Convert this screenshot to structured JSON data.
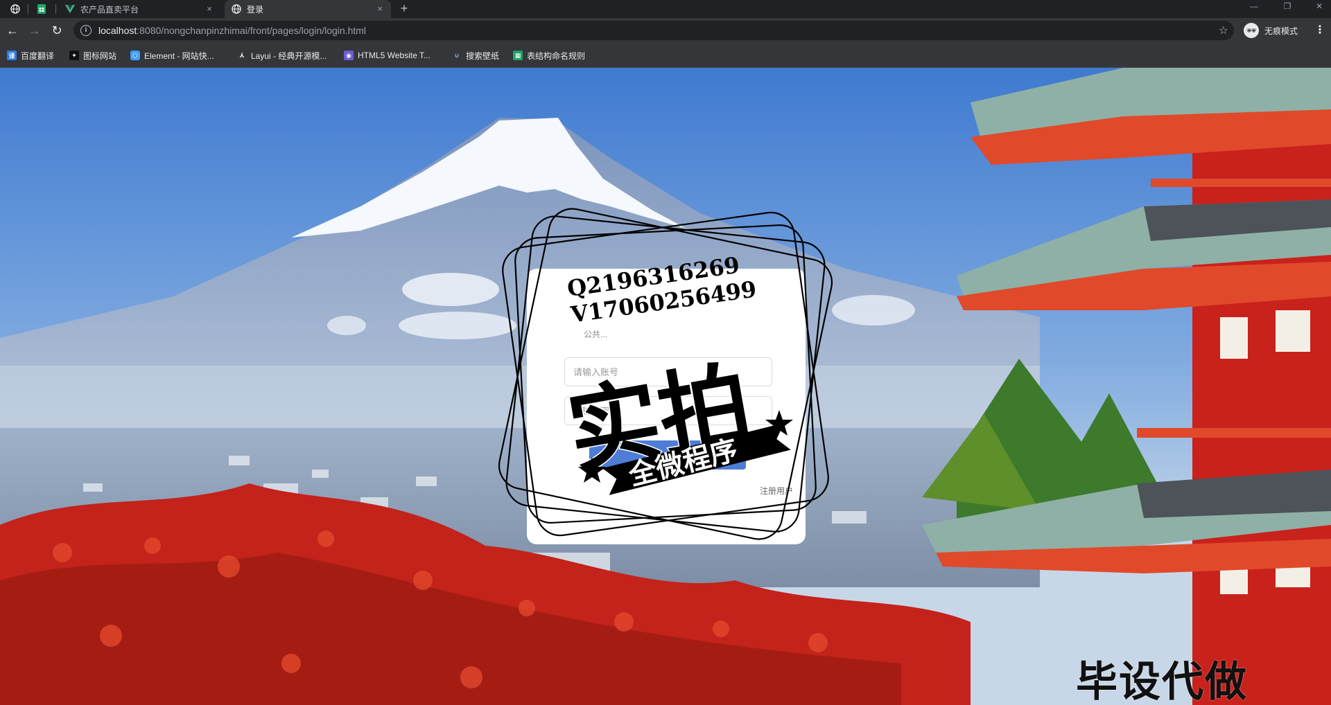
{
  "browser": {
    "tabs": [
      {
        "title": "",
        "icon": "globe-icon",
        "pinned": true
      },
      {
        "title": "",
        "icon": "sheets-icon",
        "pinned": true
      },
      {
        "title": "农产品直卖平台",
        "icon": "vue-icon",
        "active": false,
        "close": "×"
      },
      {
        "title": "登录",
        "icon": "globe-icon",
        "active": true,
        "close": "×"
      }
    ],
    "new_tab": "+",
    "url": {
      "host": "localhost",
      "rest": ":8080/nongchanpinzhimai/front/pages/login/login.html"
    },
    "incognito_label": "无痕模式",
    "bookmarks": [
      {
        "label": "百度翻译",
        "icon": "baidu-translate-icon",
        "color": "#2d7be5"
      },
      {
        "label": "图标网站",
        "icon": "iconfont-icon",
        "color": "#222222"
      },
      {
        "label": "Element - 网站快...",
        "icon": "element-icon",
        "color": "#409eff"
      },
      {
        "label": "Layui - 经典开源模...",
        "icon": "layui-icon",
        "color": "#555555"
      },
      {
        "label": "HTML5 Website T...",
        "icon": "html5-template-icon",
        "color": "#6b5bd6"
      },
      {
        "label": "搜索壁纸",
        "icon": "wallpaper-icon",
        "color": "#3a6ecf"
      },
      {
        "label": "表结构命名规则",
        "icon": "sheets-icon",
        "color": "#1fa463"
      }
    ]
  },
  "login": {
    "tip": "公共...",
    "username_placeholder": "请输入账号",
    "password_placeholder": "请输入密码",
    "submit_label": "",
    "register_label": "注册用户"
  },
  "watermark": {
    "contact_q": "Q2196316269",
    "contact_v": "V17060256499",
    "main": "实拍",
    "banner": "全微程序",
    "corner": "毕设代做"
  },
  "colors": {
    "chrome_dark": "#202124",
    "chrome_mid": "#35363a",
    "login_button": "#4e7dd6",
    "sky": "#5b8fd6",
    "pagoda_red": "#d8241c",
    "foliage": "#c8261c"
  }
}
